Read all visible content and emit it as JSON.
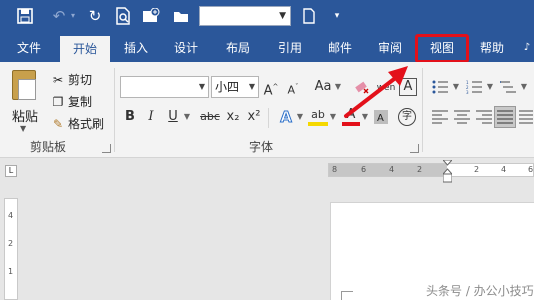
{
  "qat": {
    "font_name": ""
  },
  "tabs": [
    "文件",
    "开始",
    "插入",
    "设计",
    "布局",
    "引用",
    "邮件",
    "审阅",
    "视图",
    "帮助"
  ],
  "clipboard": {
    "paste": "粘贴",
    "cut": "剪切",
    "copy": "复制",
    "format_painter": "格式刷",
    "group": "剪贴板"
  },
  "font": {
    "name": "",
    "size": "小四",
    "grow": "A",
    "shrink": "A",
    "case": "Aa",
    "bold": "B",
    "italic": "I",
    "underline": "U",
    "strike": "abc",
    "subscript": "x₂",
    "superscript": "x²",
    "effects": "A",
    "highlight": "ab",
    "color": "A",
    "enclose": "字",
    "box": "A",
    "group": "字体"
  },
  "ruler": {
    "top_ticks": [
      "8",
      "6",
      "4",
      "2",
      "2",
      "4",
      "6"
    ],
    "left_ticks": [
      "4",
      "2",
      "1"
    ]
  },
  "watermark": "头条号 / 办公小技巧",
  "colors": {
    "accent": "#2b579a",
    "highlight_box": "#e3101a",
    "highlighter": "#f5d800",
    "font_color": "#e3101a"
  }
}
